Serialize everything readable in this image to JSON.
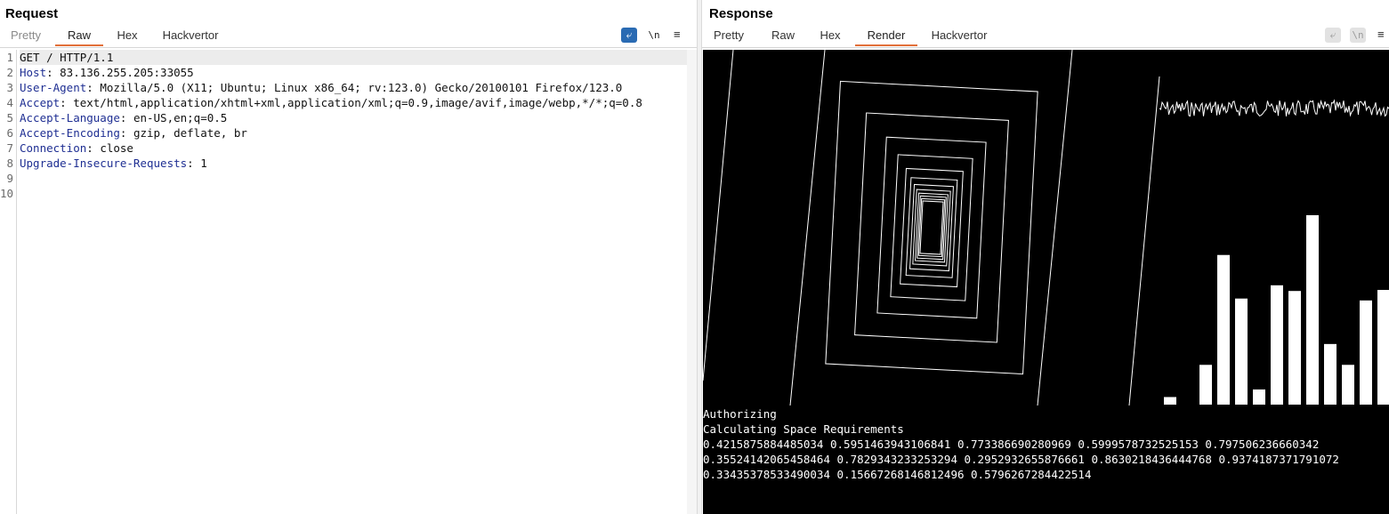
{
  "request": {
    "title": "Request",
    "tabs": [
      "Pretty",
      "Raw",
      "Hex",
      "Hackvertor"
    ],
    "active_tab": "Raw",
    "toolbar": {
      "wrap_icon": "wrap-lines-icon",
      "newline_label": "\\n",
      "menu_icon": "≡"
    },
    "line_numbers": [
      "1",
      "2",
      "3",
      "4",
      "5",
      "6",
      "7",
      "8",
      "9",
      "10"
    ],
    "lines": [
      {
        "key": "",
        "value": "GET / HTTP/1.1"
      },
      {
        "key": "Host",
        "value": ": 83.136.255.205:33055"
      },
      {
        "key": "User-Agent",
        "value": ": Mozilla/5.0 (X11; Ubuntu; Linux x86_64; rv:123.0) Gecko/20100101 Firefox/123.0"
      },
      {
        "key": "Accept",
        "value": ": text/html,application/xhtml+xml,application/xml;q=0.9,image/avif,image/webp,*/*;q=0.8"
      },
      {
        "key": "Accept-Language",
        "value": ": en-US,en;q=0.5"
      },
      {
        "key": "Accept-Encoding",
        "value": ": gzip, deflate, br"
      },
      {
        "key": "Connection",
        "value": ": close"
      },
      {
        "key": "Upgrade-Insecure-Requests",
        "value": ": 1"
      },
      {
        "key": "",
        "value": ""
      },
      {
        "key": "",
        "value": ""
      }
    ]
  },
  "response": {
    "title": "Response",
    "tabs": [
      "Pretty",
      "Raw",
      "Hex",
      "Render",
      "Hackvertor"
    ],
    "active_tab": "Render",
    "toolbar": {
      "wrap_icon": "wrap-lines-icon",
      "newline_label": "\\n",
      "menu_icon": "≡"
    },
    "render_output": [
      "Authorizing",
      "Calculating Space Requirements",
      "0.4215875884485034 0.5951463943106841 0.773386690280969 0.5999578732525153 0.797506236660342",
      "0.35524142065458464 0.7829343233253294 0.2952932655876661 0.8630218436444768 0.9374187371791072",
      "0.33435378533490034 0.15667268146812496 0.5796267284422514"
    ],
    "bar_values": [
      0.04,
      0.0,
      0.21,
      0.79,
      0.56,
      0.08,
      0.63,
      0.6,
      1.0,
      0.32,
      0.21,
      0.55,
      0.6
    ],
    "colors": {
      "background": "#000000",
      "stroke": "#ffffff"
    }
  },
  "colors": {
    "accent_orange": "#e2703a",
    "toggle_blue": "#2a6bb3",
    "header_key": "#1f2f93"
  }
}
